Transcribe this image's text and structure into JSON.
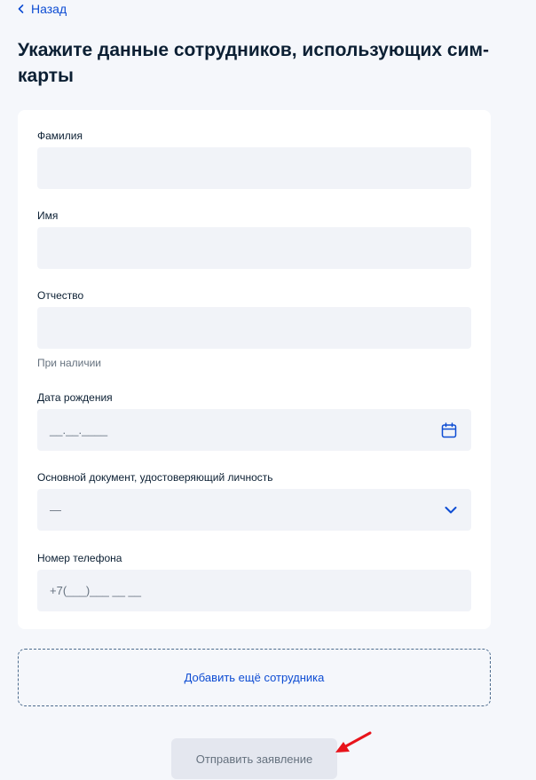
{
  "nav": {
    "back_label": "Назад"
  },
  "page": {
    "title": "Укажите данные сотрудников, использующих сим-карты"
  },
  "form": {
    "surname": {
      "label": "Фамилия",
      "value": ""
    },
    "name": {
      "label": "Имя",
      "value": ""
    },
    "patronymic": {
      "label": "Отчество",
      "value": "",
      "hint": "При наличии"
    },
    "birth_date": {
      "label": "Дата рождения",
      "placeholder": "__.__.____",
      "icon": "calendar-icon"
    },
    "document": {
      "label": "Основной документ, удостоверяющий личность",
      "selected": "—",
      "icon": "chevron-down-icon"
    },
    "phone": {
      "label": "Номер телефона",
      "placeholder": "+7(___)___ __ __"
    }
  },
  "actions": {
    "add_employee_label": "Добавить ещё сотрудника",
    "submit_label": "Отправить заявление"
  },
  "colors": {
    "accent": "#0d4cd3",
    "text": "#0b1f33",
    "muted": "#66727f",
    "input_bg": "#f1f3f8",
    "page_bg": "#f5f7fb",
    "annotation": "#e8141b"
  }
}
